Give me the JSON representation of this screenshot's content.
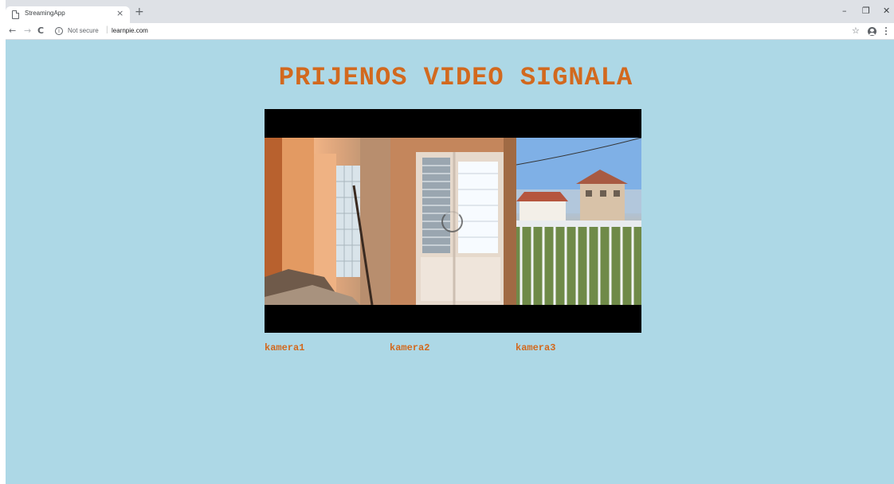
{
  "browser": {
    "tab_title": "StreamingApp",
    "tab_close": "×",
    "new_tab": "+",
    "window_controls": {
      "minimize": "–",
      "maximize": "❐",
      "close": "✕"
    },
    "nav": {
      "back": "←",
      "forward": "→",
      "reload": "C"
    },
    "security_text": "Not secure",
    "url": "learnpie.com",
    "bookmark_icon": "☆"
  },
  "page": {
    "title": "PRIJENOS VIDEO SIGNALA",
    "background_color": "#add8e6",
    "accent_color": "#d2691e",
    "cameras": [
      {
        "label": "kamera1"
      },
      {
        "label": "kamera2"
      },
      {
        "label": "kamera3"
      }
    ]
  }
}
